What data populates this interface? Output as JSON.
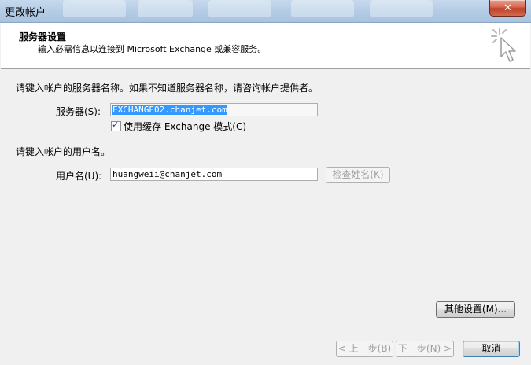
{
  "window": {
    "title": "更改帐户",
    "close_glyph": "✕"
  },
  "header": {
    "title": "服务器设置",
    "subtitle": "输入必需信息以连接到 Microsoft Exchange 或兼容服务。",
    "icon": "cursor-sparkle-icon"
  },
  "server_section": {
    "instruction": "请键入帐户的服务器名称。如果不知道服务器名称，请咨询帐户提供者。",
    "server_label": "服务器(S):",
    "server_value": "EXCHANGE02.chanjet.com",
    "cached_mode_label": "使用缓存 Exchange 模式(C)",
    "cached_mode_checked": true
  },
  "user_section": {
    "instruction": "请键入帐户的用户名。",
    "username_label": "用户名(U):",
    "username_value": "huangweii@chanjet.com",
    "check_name_button": "检查姓名(K)"
  },
  "buttons": {
    "more_settings": "其他设置(M)...",
    "back": "< 上一步(B)",
    "next": "下一步(N) >",
    "cancel": "取消"
  },
  "colors": {
    "selection": "#3399ff",
    "close_button": "#c0402a",
    "default_button_border": "#3c7fb1"
  }
}
